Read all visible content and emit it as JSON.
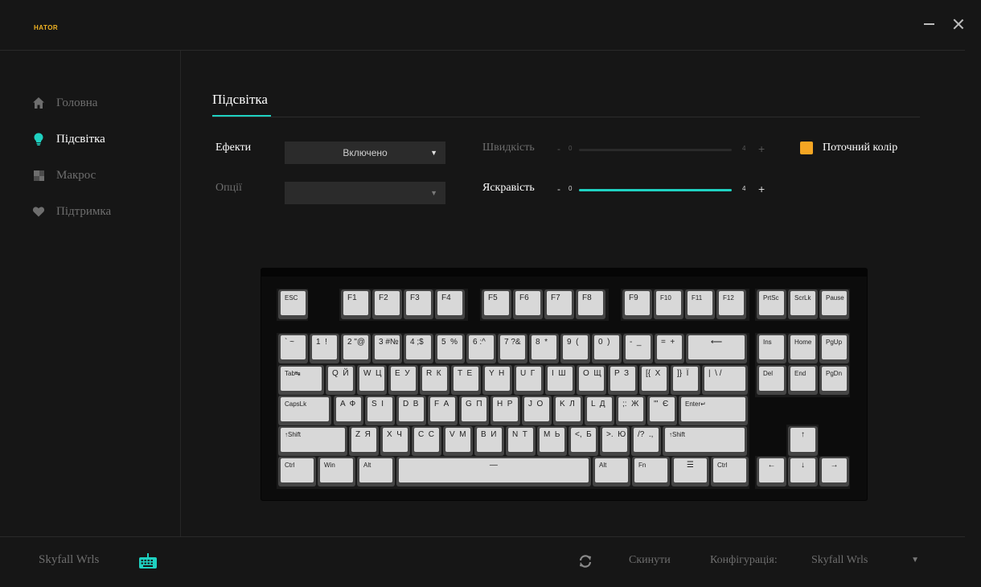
{
  "app": {
    "logo": "HATOR"
  },
  "window_controls": {
    "minimize": "minimize",
    "close": "close"
  },
  "sidebar": {
    "items": [
      {
        "label": "Головна",
        "icon": "home-icon",
        "active": false
      },
      {
        "label": "Підсвітка",
        "icon": "lightbulb-icon",
        "active": true
      },
      {
        "label": "Макрос",
        "icon": "macro-icon",
        "active": false
      },
      {
        "label": "Підтримка",
        "icon": "heart-icon",
        "active": false
      }
    ]
  },
  "main": {
    "tab": "Підсвітка",
    "effects": {
      "label": "Ефекти",
      "value": "Включено"
    },
    "options": {
      "label": "Опції",
      "value": ""
    },
    "speed": {
      "label": "Швидкість",
      "minus": "-",
      "min": "0",
      "max": "4",
      "plus": "+",
      "value": 0,
      "enabled": false
    },
    "brightness": {
      "label": "Яскравість",
      "minus": "-",
      "min": "0",
      "max": "4",
      "plus": "+",
      "value": 4,
      "enabled": true
    },
    "current_color": {
      "label": "Поточний колір",
      "color": "#f5a623"
    }
  },
  "keyboard": {
    "rows": [
      [
        "ESC",
        "F1",
        "F2",
        "F3",
        "F4",
        "F5",
        "F6",
        "F7",
        "F8",
        "F9",
        "F10",
        "F11",
        "F12",
        "PrtSc",
        "ScrLk",
        "Pause"
      ],
      [
        "` ~",
        "1  !",
        "2 \"@",
        "3 #№",
        "4 ;$",
        "5  %",
        "6 :^",
        "7 ?&",
        "8  *",
        "9  (",
        "0  )",
        "-  _",
        "=  +",
        "⟵",
        "Ins",
        "Home",
        "PgUp"
      ],
      [
        "Tab↹",
        "Q  Й",
        "W  Ц",
        "E  У",
        "R  К",
        "T  Е",
        "Y  Н",
        "U  Г",
        "I  Ш",
        "O  Щ",
        "P  З",
        "[{  Х",
        "]}  Ї",
        "|  \\ /",
        "Del",
        "End",
        "PgDn"
      ],
      [
        "CapsLk",
        "A  Ф",
        "S  І",
        "D  В",
        "F  А",
        "G  П",
        "H  Р",
        "J  О",
        "K  Л",
        "L  Д",
        ";:  Ж",
        "'\"  Є",
        "Enter↵"
      ],
      [
        "↑Shift",
        "Z  Я",
        "X  Ч",
        "C  С",
        "V  М",
        "B  И",
        "N  Т",
        "M  Ь",
        "<,  Б",
        ">.  Ю",
        "/?  .,",
        "↑Shift",
        "↑"
      ],
      [
        "Ctrl",
        "Win",
        "Alt",
        "—",
        "Alt",
        "Fn",
        "☰",
        "Ctrl",
        "←",
        "↓",
        "→"
      ]
    ]
  },
  "footer": {
    "device_name": "Skyfall Wrls",
    "device_icon": "keyboard-icon",
    "reset_label": "Скинути",
    "config_label": "Конфігурація:",
    "config_value": "Skyfall Wrls"
  }
}
